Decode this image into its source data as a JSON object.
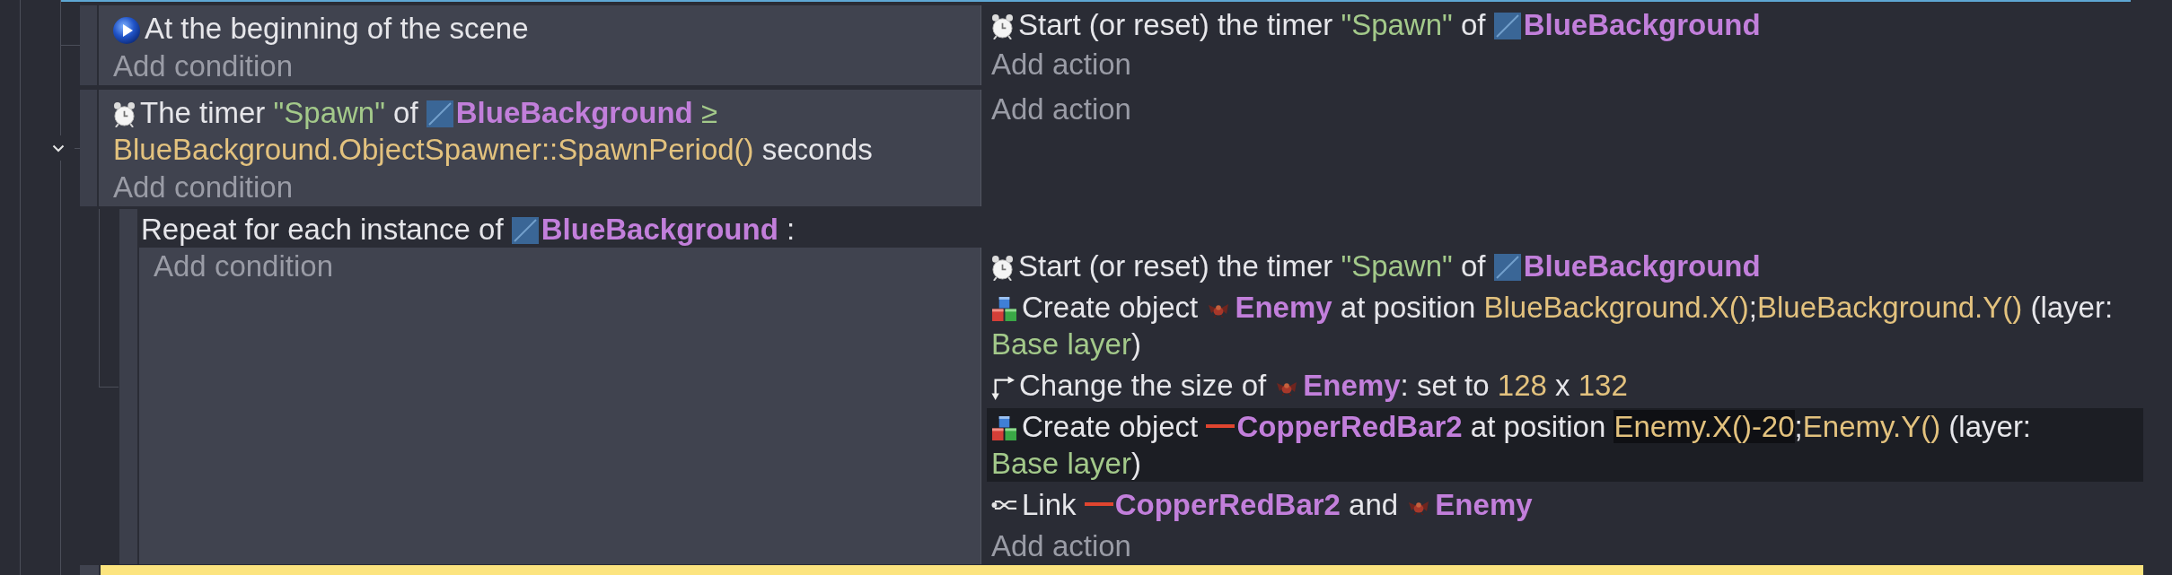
{
  "events": [
    {
      "kind": "standard",
      "conditions": [
        {
          "kind": "scenestart",
          "segments": [
            {
              "kind": "text",
              "text": "At the beginning of the scene"
            }
          ]
        }
      ],
      "add_condition": "Add condition",
      "actions": [
        {
          "kind": "timer",
          "highlighted": false,
          "segments": [
            {
              "kind": "text",
              "text": "Start (or reset) the timer "
            },
            {
              "kind": "string",
              "text": "\"Spawn\""
            },
            {
              "kind": "text",
              "text": " of "
            },
            {
              "kind": "tile",
              "text": "BlueBackground"
            }
          ]
        }
      ],
      "add_action": "Add action"
    },
    {
      "kind": "standard",
      "expanded": true,
      "conditions": [
        {
          "kind": "timer",
          "segments": [
            {
              "kind": "text",
              "text": "The timer "
            },
            {
              "kind": "string",
              "text": "\"Spawn\""
            },
            {
              "kind": "text",
              "text": " of "
            },
            {
              "kind": "tile",
              "text": "BlueBackground"
            },
            {
              "kind": "operator",
              "text": " ≥ "
            },
            {
              "kind": "expression",
              "highlighted": false,
              "text": "BlueBackground.ObjectSpawner::SpawnPeriod()"
            },
            {
              "kind": "text",
              "text": " seconds"
            }
          ]
        }
      ],
      "add_condition": "Add condition",
      "add_action": "Add action",
      "children": [
        {
          "kind": "foreach",
          "header": [
            {
              "kind": "text",
              "text": "Repeat for each instance of "
            },
            {
              "kind": "tile",
              "text": "BlueBackground"
            },
            {
              "kind": "text",
              "text": " :"
            }
          ],
          "add_condition": "Add condition",
          "actions": [
            {
              "kind": "timer",
              "highlighted": false,
              "segments": [
                {
                  "kind": "text",
                  "text": "Start (or reset) the timer "
                },
                {
                  "kind": "string",
                  "text": "\"Spawn\""
                },
                {
                  "kind": "text",
                  "text": " of "
                },
                {
                  "kind": "tile",
                  "text": "BlueBackground"
                }
              ]
            },
            {
              "kind": "create",
              "highlighted": false,
              "segments": [
                {
                  "kind": "text",
                  "text": "Create object "
                },
                {
                  "kind": "sprite",
                  "text": "Enemy"
                },
                {
                  "kind": "text",
                  "text": " at position "
                },
                {
                  "kind": "expression",
                  "highlighted": false,
                  "text": "BlueBackground.X()"
                },
                {
                  "kind": "text",
                  "text": ";"
                },
                {
                  "kind": "expression",
                  "highlighted": false,
                  "text": "BlueBackground.Y()"
                },
                {
                  "kind": "text",
                  "text": " (layer: "
                },
                {
                  "kind": "string",
                  "text": "Base layer"
                },
                {
                  "kind": "text",
                  "text": ")"
                }
              ]
            },
            {
              "kind": "resize",
              "highlighted": false,
              "segments": [
                {
                  "kind": "text",
                  "text": "Change the size of "
                },
                {
                  "kind": "sprite",
                  "text": "Enemy"
                },
                {
                  "kind": "text",
                  "text": ": set to "
                },
                {
                  "kind": "expression",
                  "highlighted": false,
                  "text": "128"
                },
                {
                  "kind": "text",
                  "text": " x "
                },
                {
                  "kind": "expression",
                  "highlighted": false,
                  "text": "132"
                }
              ]
            },
            {
              "kind": "create",
              "highlighted": true,
              "segments": [
                {
                  "kind": "text",
                  "text": "Create object "
                },
                {
                  "kind": "bar",
                  "text": "CopperRedBar2"
                },
                {
                  "kind": "text",
                  "text": " at position "
                },
                {
                  "kind": "expression",
                  "highlighted": true,
                  "text": "Enemy.X()-20"
                },
                {
                  "kind": "text",
                  "text": ";"
                },
                {
                  "kind": "expression",
                  "highlighted": false,
                  "text": "Enemy.Y()"
                },
                {
                  "kind": "text",
                  "text": " (layer: "
                },
                {
                  "kind": "string",
                  "text": "Base layer"
                },
                {
                  "kind": "text",
                  "text": ")"
                }
              ]
            },
            {
              "kind": "link",
              "highlighted": false,
              "segments": [
                {
                  "kind": "text",
                  "text": "Link "
                },
                {
                  "kind": "bar",
                  "text": "CopperRedBar2"
                },
                {
                  "kind": "text",
                  "text": " and "
                },
                {
                  "kind": "sprite",
                  "text": "Enemy"
                }
              ]
            }
          ],
          "add_action": "Add action"
        }
      ]
    },
    {
      "kind": "comment"
    }
  ]
}
